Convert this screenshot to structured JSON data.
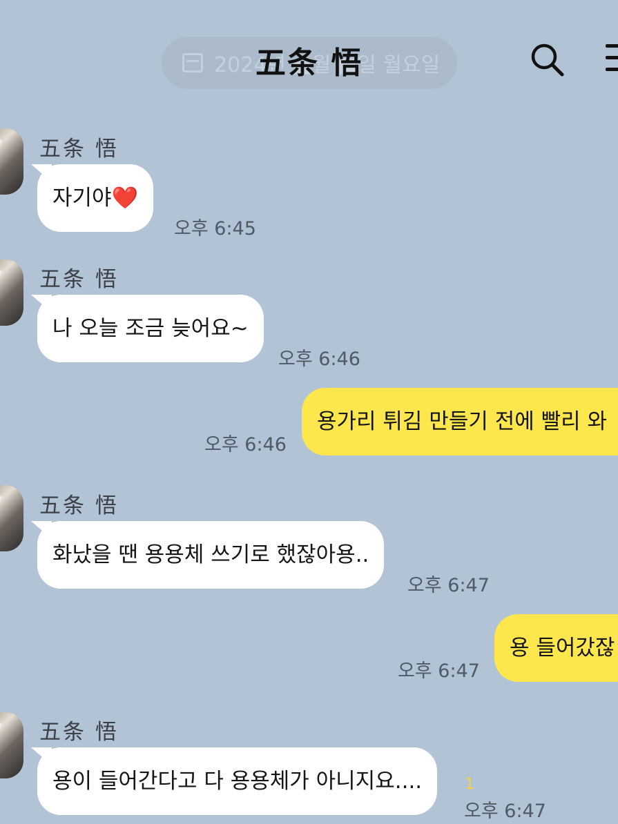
{
  "header": {
    "date_text": "2024년 ■월 ■일 월요일",
    "title": "五条 悟",
    "search_icon": "search-icon",
    "menu_icon": "menu-icon"
  },
  "messages": [
    {
      "direction": "incoming",
      "sender": "五条 悟",
      "text": "자기야",
      "emoji": "❤️",
      "time": "오후 6:45"
    },
    {
      "direction": "incoming",
      "sender": "五条 悟",
      "text": "나 오늘 조금 늦어요~",
      "time": "오후 6:46"
    },
    {
      "direction": "outgoing",
      "text": "용가리 튀김 만들기 전에 빨리 와",
      "time": "오후 6:46"
    },
    {
      "direction": "incoming",
      "sender": "五条 悟",
      "text": "화났을 땐 용용체 쓰기로 했잖아용..",
      "time": "오후 6:47"
    },
    {
      "direction": "outgoing",
      "text": "용 들어갔잖",
      "time": "오후 6:47"
    },
    {
      "direction": "incoming",
      "sender": "五条 悟",
      "text": "용이 들어간다고 다 용용체가 아니지요....",
      "time": "오후 6:47",
      "unread_count": "1"
    }
  ],
  "colors": {
    "background": "#b2c3d5",
    "incoming_bubble": "#ffffff",
    "outgoing_bubble": "#fee64d",
    "unread": "#f5d536"
  }
}
